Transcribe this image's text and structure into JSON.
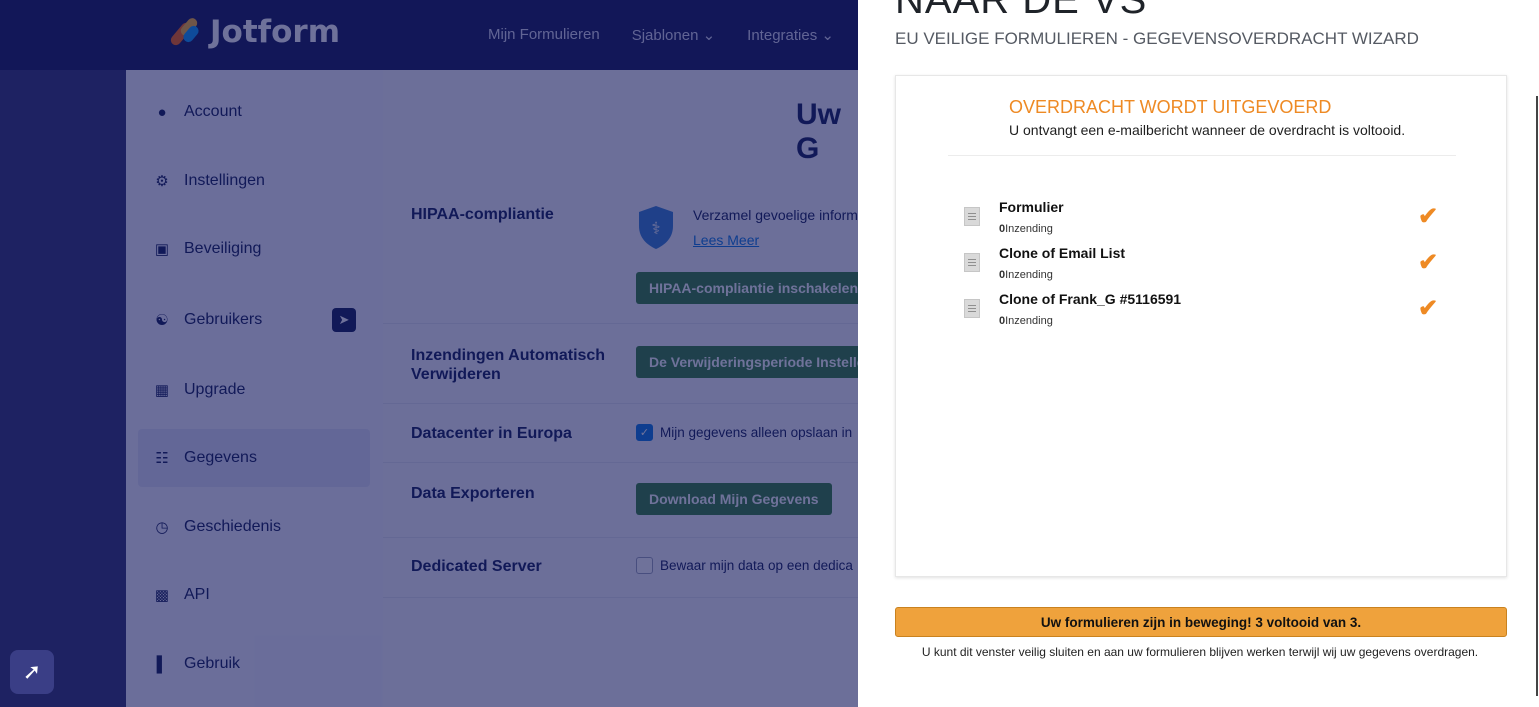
{
  "brand": {
    "name": "Jotform"
  },
  "topnav": [
    "Mijn Formulieren",
    "Sjablonen ⌄",
    "Integraties ⌄"
  ],
  "sidebar": {
    "items": [
      {
        "label": "Account",
        "icon": "user-icon"
      },
      {
        "label": "Instellingen",
        "icon": "gear-icon"
      },
      {
        "label": "Beveiliging",
        "icon": "lock-icon"
      },
      {
        "label": "Gebruikers",
        "icon": "users-icon"
      },
      {
        "label": "Upgrade",
        "icon": "upgrade-icon"
      },
      {
        "label": "Gegevens",
        "icon": "database-icon",
        "active": true
      },
      {
        "label": "Geschiedenis",
        "icon": "history-icon"
      },
      {
        "label": "API",
        "icon": "api-icon"
      },
      {
        "label": "Gebruik",
        "icon": "bar-chart-icon"
      }
    ]
  },
  "content": {
    "heading": "Uw G",
    "rows": {
      "hipaa_label": "HIPAA-compliantie",
      "hipaa_text": "Verzamel gevoelige inform",
      "hipaa_link": "Lees Meer",
      "hipaa_button": "HIPAA-compliantie inschakelen",
      "autodelete_label": "Inzendingen Automatisch Verwijderen",
      "autodelete_button": "De Verwijderingsperiode Instelle",
      "datacenter_label": "Datacenter in Europa",
      "datacenter_check": "Mijn gegevens alleen opslaan in",
      "export_label": "Data Exporteren",
      "export_button": "Download Mijn Gegevens",
      "dedicated_label": "Dedicated Server",
      "dedicated_check": "Bewaar mijn data op een dedica"
    }
  },
  "wizard": {
    "title": "NAAR DE VS",
    "subtitle": "EU VEILIGE FORMULIEREN - GEGEVENSOVERDRACHT WIZARD",
    "status_title": "OVERDRACHT WORDT UITGEVOERD",
    "status_sub": "U ontvangt een e-mailbericht wanneer de overdracht is voltooid.",
    "forms": [
      {
        "name": "Formulier",
        "count": "0",
        "count_label": "Inzending"
      },
      {
        "name": "Clone of Email List",
        "count": "0",
        "count_label": "Inzending"
      },
      {
        "name": "Clone of Frank_G  #5116591",
        "count": "0",
        "count_label": "Inzending"
      }
    ],
    "progress_text": "Uw formulieren zijn in beweging! 3 voltooid van 3.",
    "note": "U kunt dit venster veilig sluiten en aan uw formulieren blijven werken terwijl wij uw gegevens overdragen.",
    "accent_color": "#ee8a24"
  }
}
